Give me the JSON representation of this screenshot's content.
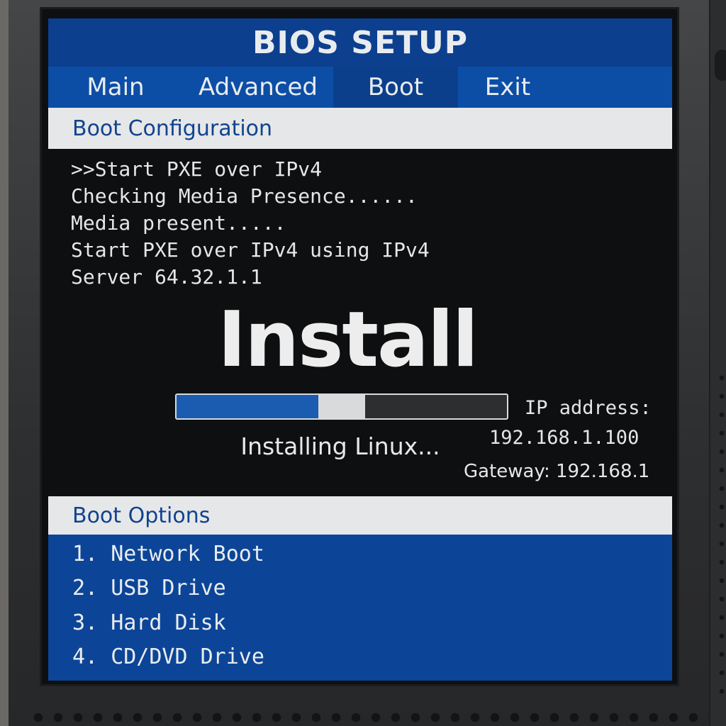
{
  "bios": {
    "title": "BIOS SETUP",
    "menu": [
      {
        "label": "Main",
        "active": false
      },
      {
        "label": "Advanced",
        "active": false
      },
      {
        "label": "Boot",
        "active": true
      },
      {
        "label": "Exit",
        "active": false
      }
    ]
  },
  "boot_config": {
    "header": "Boot Configuration",
    "console_lines": [
      ">>Start PXE over IPv4",
      "Checking Media Presence......",
      "Media present.....",
      "Start PXE over IPv4 using IPv4",
      "Server 64.32.1.1"
    ]
  },
  "install": {
    "title": "Install",
    "status": "Installing Linux...",
    "progress_fraction": 0.57,
    "progress_segment_start": 0.43
  },
  "network": {
    "ip_label": "IP address:",
    "ip_value": "192.168.1.100",
    "gateway_label": "Gateway:",
    "gateway_value": "192.168.1"
  },
  "boot_options": {
    "header": "Boot Options",
    "items": [
      {
        "number": "1.",
        "label": "Network Boot"
      },
      {
        "number": "2.",
        "label": "USB Drive"
      },
      {
        "number": "3.",
        "label": "Hard Disk"
      },
      {
        "number": "4.",
        "label": "CD/DVD Drive"
      }
    ]
  },
  "colors": {
    "title_bar": "#0d3f8f",
    "menu_bar": "#0c4ea6",
    "section_header_bg": "#e6e7e8",
    "section_header_text": "#10438f",
    "options_bg": "#0c4597",
    "progress_blue": "#1b5bb0"
  }
}
